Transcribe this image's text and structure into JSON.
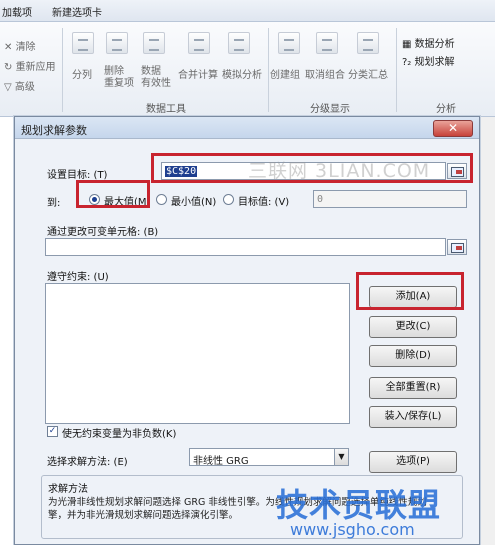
{
  "ribbon": {
    "tabs": [
      "加载项",
      "新建选项卡"
    ],
    "left_items": [
      "清除",
      "重新应用",
      "高级"
    ],
    "items": [
      "分列",
      "删除\n重复项",
      "数据\n有效性",
      "合并计算",
      "模拟分析",
      "创建组",
      "取消组合",
      "分类汇总"
    ],
    "right_items": [
      "数据分析",
      "规划求解"
    ],
    "groups": [
      "数据工具",
      "分级显示",
      "分析"
    ]
  },
  "dialog": {
    "title": "规划求解参数",
    "close_label": "✕",
    "target_label": "设置目标: (T)",
    "target_value": "$C$20",
    "to_label": "到:",
    "radios": [
      {
        "label": "最大值(M)",
        "checked": true
      },
      {
        "label": "最小值(N)",
        "checked": false
      },
      {
        "label": "目标值: (V)",
        "checked": false
      }
    ],
    "target_value_input": "0",
    "changing_label": "通过更改可变单元格: (B)",
    "constraints_label": "遵守约束: (U)",
    "buttons": {
      "add": "添加(A)",
      "change": "更改(C)",
      "delete": "删除(D)",
      "reset_all": "全部重置(R)",
      "load_save": "装入/保存(L)",
      "options": "选项(P)"
    },
    "checkbox_label": "使无约束变量为非负数(K)",
    "checkbox_checked": true,
    "method_label": "选择求解方法: (E)",
    "method_value": "非线性 GRG",
    "method_group_title": "求解方法",
    "method_description_line1": "为光滑非线性规划求解问题选择 GRG 非线性引擎。为线性规划求解问题选择单纯线性规划",
    "method_description_line2": "擎，并为非光滑规划求解问题选择演化引擎。"
  },
  "watermarks": {
    "top": "三联网 3LIAN.COM",
    "bottom_logo": "技术员联盟",
    "bottom_url": "www.jsgho.com"
  },
  "colors": {
    "highlight": "#c8242f",
    "logo_blue": "#2a6fd6",
    "close_red": "#c7423a"
  }
}
